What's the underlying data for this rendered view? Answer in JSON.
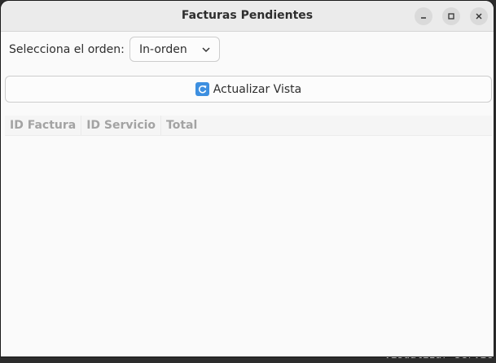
{
  "window": {
    "title": "Facturas Pendientes"
  },
  "controls": {
    "order_label": "Selecciona el orden:",
    "order_selected": "In-orden",
    "refresh_label": "Actualizar Vista"
  },
  "table": {
    "columns": [
      "ID Factura",
      "ID Servicio",
      "Total"
    ],
    "rows": []
  },
  "background": {
    "terminal_text": "- **Visualizar Servic"
  },
  "colors": {
    "titlebar": "#ebebeb",
    "window_bg": "#fafafa",
    "header_text": "#a3a3a3",
    "refresh_icon": "#3d8fe0"
  }
}
